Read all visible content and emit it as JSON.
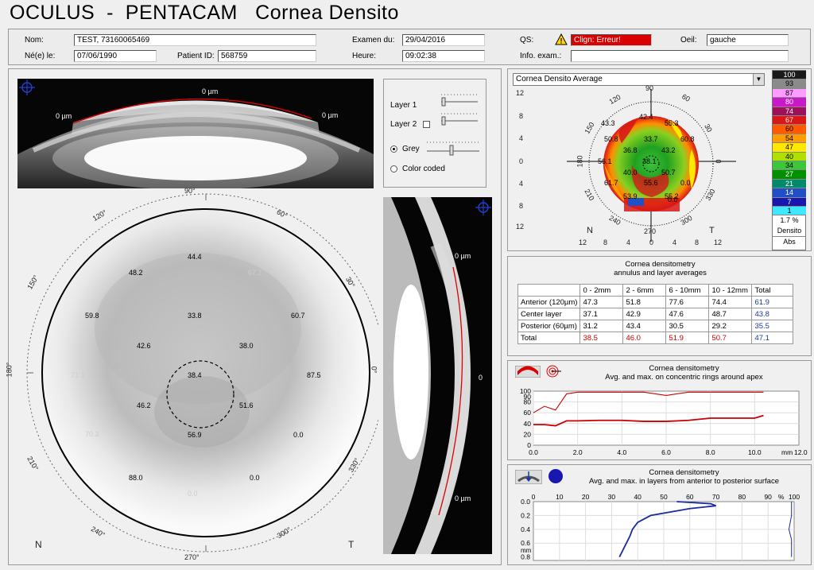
{
  "app": {
    "title": "OCULUS  -  PENTACAM   Cornea Densito"
  },
  "header": {
    "nom_label": "Nom:",
    "nom_value": "TEST, 73160065469",
    "dob_label": "Né(e) le:",
    "dob_value": "07/06/1990",
    "patient_label": "Patient ID:",
    "patient_value": "568759",
    "exam_label": "Examen du:",
    "exam_value": "29/04/2016",
    "heure_label": "Heure:",
    "heure_value": "09:02:38",
    "qs_label": "QS:",
    "qs_value": "Clign: Erreur!",
    "oeil_label": "Oeil:",
    "oeil_value": "gauche",
    "info_label": "Info. exam.:",
    "info_value": ""
  },
  "scheimpflug_top": {
    "labels": [
      "0 µm",
      "0 µm",
      "0 µm"
    ]
  },
  "layer_controls": {
    "layer1": "Layer 1",
    "layer2": "Layer 2",
    "grey": "Grey",
    "color_coded": "Color coded"
  },
  "polar": {
    "angles": [
      "90°",
      "60°",
      "30°",
      "0°",
      "330°",
      "300°",
      "270°",
      "240°",
      "210°",
      "180°",
      "150°",
      "120°"
    ],
    "n_label": "N",
    "t_label": "T",
    "values": [
      "44.4",
      "67.1",
      "48.2",
      "59.8",
      "33.8",
      "60.7",
      "42.6",
      "38.0",
      "71.1",
      "38.4",
      "87.5",
      "46.2",
      "51.6",
      "70.3",
      "56.9",
      "0.0",
      "88.0",
      "0.0",
      "0.0"
    ]
  },
  "scheimpflug_side": {
    "labels": [
      "0 µm",
      "0",
      "0 µm"
    ]
  },
  "map": {
    "dropdown": "Cornea Densito Average",
    "y_ticks": [
      "12",
      "8",
      "4",
      "0",
      "4",
      "8",
      "12"
    ],
    "x_ticks": [
      "12",
      "8",
      "4",
      "0",
      "4",
      "8",
      "12"
    ],
    "angles": [
      "90",
      "60",
      "30",
      "0",
      "330",
      "300",
      "270",
      "240",
      "210",
      "180",
      "150",
      "120"
    ],
    "n_label": "N",
    "t_label": "T",
    "values": [
      "42.4",
      "43.3",
      "55.3",
      "50.8",
      "33.7",
      "60.8",
      "36.8",
      "43.2",
      "56.1",
      "38.1",
      "40.0",
      "50.7",
      "61.7",
      "55.6",
      "0.0",
      "53.9",
      "55.2",
      "0.0"
    ]
  },
  "scale": {
    "values": [
      "100",
      "93",
      "87",
      "80",
      "74",
      "67",
      "60",
      "54",
      "47",
      "40",
      "34",
      "27",
      "21",
      "14",
      "7",
      "1"
    ],
    "colors": [
      "#1a1a1a",
      "#8a8a8a",
      "#ff9cff",
      "#c818c8",
      "#a0105a",
      "#d81818",
      "#ff5a00",
      "#ff9c00",
      "#ffe800",
      "#b0e000",
      "#38c838",
      "#009000",
      "#008a6a",
      "#2050c8",
      "#1818b0",
      "#40e8ff"
    ],
    "footer": [
      "1.7 %",
      "Densito",
      "Abs"
    ]
  },
  "densitometry": {
    "title1": "Cornea densitometry",
    "title2": "annulus and layer averages",
    "columns": [
      "",
      "0 - 2mm",
      "2 - 6mm",
      "6 - 10mm",
      "10 - 12mm",
      "Total"
    ],
    "rows": [
      {
        "label": "Anterior (120µm)",
        "values": [
          "47.3",
          "51.8",
          "77.6",
          "74.4",
          "61.9"
        ]
      },
      {
        "label": "Center layer",
        "values": [
          "37.1",
          "42.9",
          "47.6",
          "48.7",
          "43.8"
        ]
      },
      {
        "label": "Posterior (60µm)",
        "values": [
          "31.2",
          "43.4",
          "30.5",
          "29.2",
          "35.5"
        ]
      },
      {
        "label": "Total",
        "values": [
          "38.5",
          "46.0",
          "51.9",
          "50.7",
          "47.1"
        ]
      }
    ]
  },
  "chart_rings": {
    "title1": "Cornea densitometry",
    "title2": "Avg. and max. on concentric rings around apex",
    "x_ticks": [
      "0.0",
      "2.0",
      "4.0",
      "6.0",
      "8.0",
      "10.0"
    ],
    "x_unit": "mm",
    "x_last": "12.0",
    "y_ticks": [
      "100",
      "90",
      "80",
      "60",
      "40",
      "20",
      "0"
    ]
  },
  "chart_layers": {
    "title1": "Cornea densitometry",
    "title2": "Avg. and max. in layers from anterior to posterior surface",
    "x_ticks": [
      "0",
      "10",
      "20",
      "30",
      "40",
      "50",
      "60",
      "70",
      "80",
      "90",
      "100"
    ],
    "x_unit": "%",
    "y_ticks": [
      "0.0",
      "0.2",
      "0.4",
      "0.6",
      "0.8"
    ],
    "y_unit": "mm"
  },
  "chart_data": [
    {
      "type": "line",
      "x": [
        0,
        0.5,
        1,
        1.5,
        2,
        3,
        4,
        5,
        6,
        7,
        8,
        9,
        10,
        10.4
      ],
      "series": [
        {
          "values": [
            60,
            72,
            65,
            95,
            98,
            98,
            98,
            98,
            92,
            98,
            98,
            98,
            98,
            98
          ]
        },
        {
          "values": [
            38,
            38,
            36,
            45,
            45,
            46,
            46,
            44,
            44,
            46,
            50,
            50,
            50,
            55
          ]
        }
      ],
      "ylim": [
        0,
        100
      ],
      "xlim": [
        0,
        12
      ]
    },
    {
      "type": "line",
      "x_axis": "density",
      "y_axis": "depth",
      "series": [
        {
          "x": [
            55,
            68,
            70,
            60,
            45,
            40,
            38,
            37,
            35,
            33
          ],
          "y": [
            0.0,
            0.03,
            0.06,
            0.1,
            0.2,
            0.3,
            0.4,
            0.5,
            0.65,
            0.8
          ]
        },
        {
          "x": [
            99,
            99,
            98,
            99,
            99,
            99
          ],
          "y": [
            0.0,
            0.2,
            0.4,
            0.55,
            0.7,
            0.8
          ]
        }
      ],
      "xlim": [
        0,
        100
      ],
      "ylim": [
        0,
        0.85
      ]
    }
  ]
}
